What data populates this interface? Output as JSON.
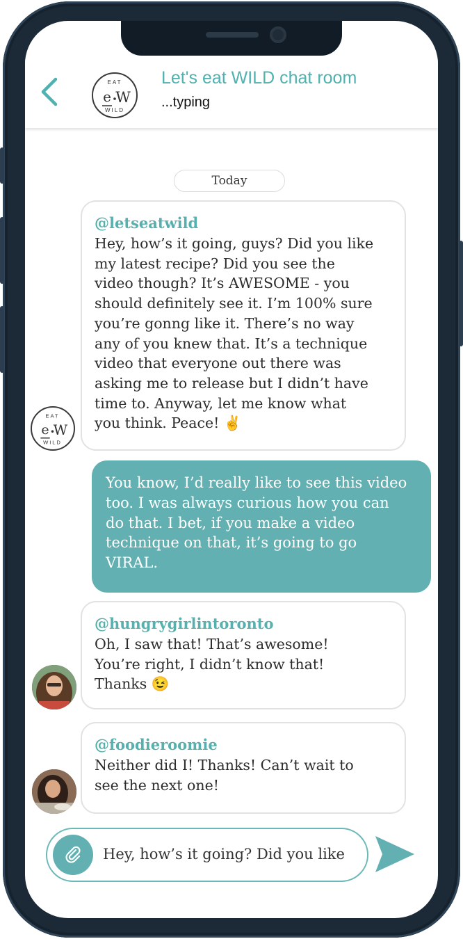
{
  "colors": {
    "accent": "#62b0b1",
    "title": "#4fb1b0",
    "frame": "#1c2a38"
  },
  "header": {
    "back_icon": "chevron-left-icon",
    "title": "Let's eat WILD chat room",
    "status": "...typing",
    "logo": {
      "top": "EAT",
      "center_e": "e",
      "center_w": "W",
      "bottom": "WILD"
    }
  },
  "date_separator": "Today",
  "messages": [
    {
      "user": "@letseatwild",
      "lines": [
        "Hey, how’s it going, guys? Did you like",
        "my latest recipe? Did you see the",
        "video though? It’s AWESOME - you",
        "should definitely see it. I’m 100% sure",
        "you’re gonng like it. There’s no way",
        "any of you knew that. It’s a technique",
        "video that everyone out there was",
        "asking me to release but I didn’t have",
        "time to. Anyway, let me know what",
        "you think. Peace! ✌️"
      ]
    },
    {
      "user": "",
      "outgoing": true,
      "lines": [
        "You know, I’d really like to see this video",
        "too. I was always curious how you can",
        "do that. I bet, if you make a video",
        "technique on that, it’s going to go",
        "VIRAL."
      ]
    },
    {
      "user": "@hungrygirlintoronto",
      "lines": [
        "Oh, I saw that! That’s awesome!",
        "You’re right, I didn’t know that!",
        "Thanks 😉"
      ]
    },
    {
      "user": "@foodieroomie",
      "lines": [
        "Neither did I! Thanks! Can’t wait to",
        "see the next one!"
      ]
    }
  ],
  "composer": {
    "value": "Hey, how’s it going? Did you like",
    "attach_icon": "paperclip-icon",
    "send_icon": "send-icon"
  }
}
